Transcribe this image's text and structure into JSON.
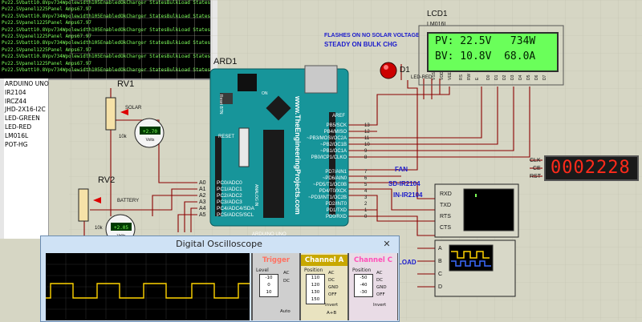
{
  "terminal": {
    "lines": [
      "Pv22.5Vbatt10.8Vpv734Wpolewidth105EnabledOkCharger StatesBulkLoad StatesOff",
      "Pv22.5Vpanel1225Panel Amps67.97",
      "Pv22.5Vbatt10.8Vpv734Wpolewidth105EnabledOkCharger StatesBulkLoad StatesOff",
      "Pv22.5Vpanel1225Panel Amps67.97",
      "Pv22.5Vbatt10.8Vpv734Wpolewidth105EnabledOkCharger StatesBulkLoad StatesOff",
      "Pv22.5Vpanel1225Panel Amps67.97",
      "Pv22.5Vbatt10.8Vpv734Wpolewidth105EnabledOkCharger StatesBulkLoad StatesOff",
      "Pv22.5Vpanel1225Panel Amps67.97",
      "Pv22.5Vbatt10.8Vpv734Wpolewidth105EnabledOkCharger StatesBulkLoad StatesOff",
      "Pv22.5Vpanel1225Panel Amps67.97",
      "Pv22.5Vbatt10.8Vpv734Wpolewidth105EnabledOkCharger StatesBulkLoad StatesOff"
    ]
  },
  "parts": [
    "ARDUINO UNO",
    "IR2104",
    "IRCZ44",
    "JHD-2X16-I2C",
    "LED-GREEN",
    "LED-RED",
    "LM016L",
    "POT-HG"
  ],
  "schematic": {
    "ard_ref": "ARD1",
    "rv1": "RV1",
    "rv2": "RV2",
    "solar": "SOLAR",
    "battery": "BATTERY",
    "ohm1": "10k",
    "ohm2": "10k",
    "volt1": "+2.70",
    "volt2": "+2.05",
    "volts": "Volts",
    "lcd_ref": "LCD1",
    "lcd_part": "LM016L",
    "lcd_line1": "PV: 22.5V   734W",
    "lcd_line2": "BV: 10.8V  68.0A",
    "note1": "FLASHES ON NO SOLAR VOLTAGE",
    "note2": "STEADY ON BULK CHG",
    "led_ref": "D1",
    "led_part": "LED-RED",
    "fan": "FAN",
    "sd": "SD-IR2104",
    "in": "IN-IR2104",
    "load": "LOAD",
    "seg_value": "0002228",
    "clk": "CLK",
    "ce": "CE",
    "rst": "RST",
    "aref": "AREF",
    "reset": "RESET",
    "reset_btn": "Reset BTN",
    "on": "ON",
    "brand": "www.TheEngineeringProjects.com",
    "analog_in": "ANALOG IN",
    "arduino_uno": "ARDUINO UNO",
    "uart": [
      "RXD",
      "TXD",
      "RTS",
      "CTS"
    ],
    "scope_ch": [
      "A",
      "B",
      "C",
      "D"
    ],
    "a_pins": [
      "A0",
      "A1",
      "A2",
      "A3",
      "A4",
      "A5"
    ],
    "pc_pins": [
      "PC0/ADC0",
      "PC1/ADC1",
      "PC2/ADC2",
      "PC3/ADC3",
      "PC4/ADC4/SDA",
      "PC5/ADC5/SCL"
    ],
    "pb_pins": [
      "PB5/SCK",
      "PB4/MISO",
      "~PB3/MOSI/OC2A",
      "~PB2/OC1B",
      "~PB1/OC1A",
      "PB0/ICP1/CLKO"
    ],
    "pd_pins": [
      "PD7/AIN1",
      "~PD6/AIN0",
      "~PD5/T1/OC0B",
      "PD4/T0/XCK",
      "~PD3/INT1/OC2B",
      "PD2/INT0",
      "PD1/TXD",
      "PD0/RXD"
    ],
    "pin_nums_top": [
      "13",
      "12",
      "11",
      "10",
      "9",
      "8"
    ],
    "pin_nums_bot": [
      "7",
      "6",
      "5",
      "4",
      "3",
      "2",
      "1",
      "0"
    ],
    "lcd_pins": [
      "VSS",
      "VDD",
      "VEE",
      "RS",
      "RW",
      "E",
      "D0",
      "D1",
      "D2",
      "D3",
      "D4",
      "D5",
      "D6",
      "D7"
    ]
  },
  "oscilloscope": {
    "title": "Digital Oscilloscope",
    "close": "✕",
    "trigger": "Trigger",
    "level": "Level",
    "channel_a": "Channel A",
    "channel_c": "Channel C",
    "position": "Position",
    "ac": "AC",
    "dc": "DC",
    "gnd": "GND",
    "off": "OFF",
    "invert": "Invert",
    "a_plus_b": "A+B",
    "auto": "Auto",
    "scale_trig": [
      "-10",
      "0",
      "10"
    ],
    "scale_a": [
      "110",
      "120",
      "130",
      "150"
    ],
    "scale_c": [
      "-50",
      "-40",
      "-30"
    ]
  },
  "colors": {
    "terminal_text": "#7dff5a",
    "lcd_bg": "#6aff5a",
    "wire": "#8b0000",
    "note": "#1a1acd",
    "seg_red": "#ff2a1a",
    "ch_a": "#ffd400",
    "ch_c": "#ff7bd5",
    "trigger": "#ff7060"
  }
}
